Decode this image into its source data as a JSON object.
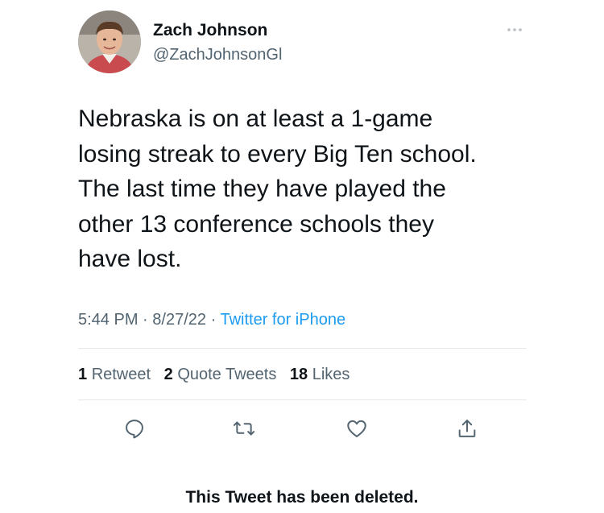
{
  "tweet": {
    "author": {
      "display_name": "Zach Johnson",
      "handle": "@ZachJohnsonGl"
    },
    "text": "Nebraska is on at least a 1-game\nlosing streak to every Big Ten school.\nThe last time they have played the\nother 13 conference schools they\nhave lost.",
    "time": "5:44 PM",
    "separator": "·",
    "date": "8/27/22",
    "source": "Twitter for iPhone",
    "stats": {
      "retweets_count": "1",
      "retweets_label": "Retweet",
      "quote_count": "2",
      "quote_label": "Quote Tweets",
      "likes_count": "18",
      "likes_label": "Likes"
    },
    "actions": [
      "reply-icon",
      "retweet-icon",
      "like-icon",
      "share-icon"
    ],
    "icon_color": "#536471",
    "link_color": "#1d9bf0"
  },
  "footer_notice": "This Tweet has been deleted."
}
